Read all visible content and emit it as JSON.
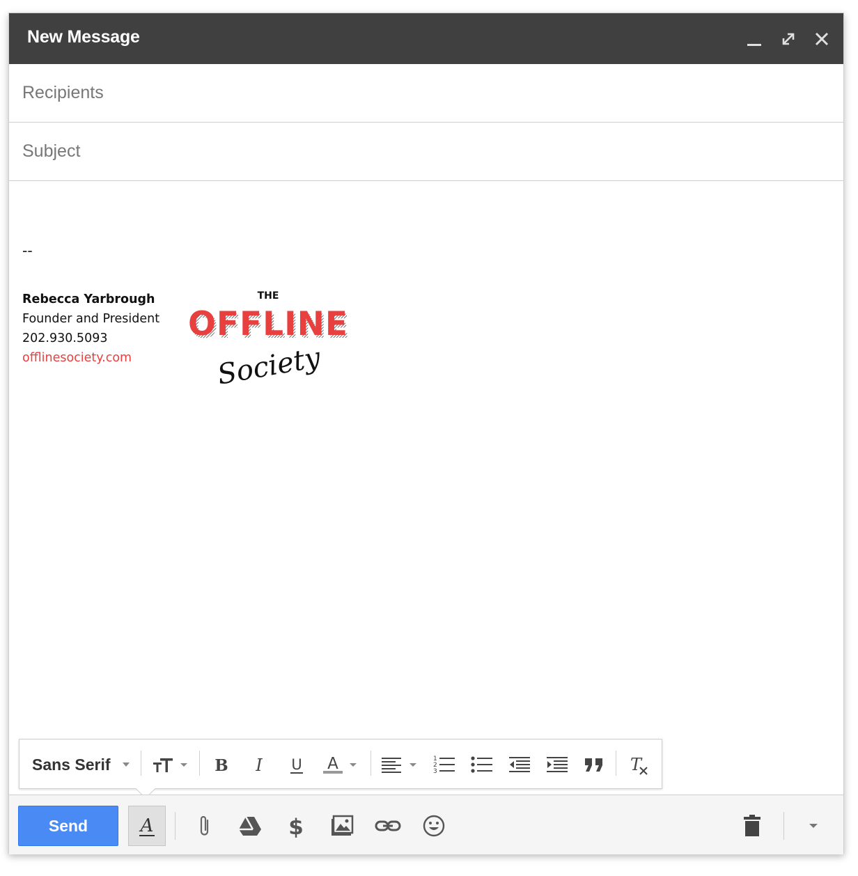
{
  "window": {
    "title": "New Message"
  },
  "fields": {
    "recipients_placeholder": "Recipients",
    "subject_placeholder": "Subject"
  },
  "signature": {
    "dash": "--",
    "name": "Rebecca Yarbrough",
    "role": "Founder and President",
    "phone": "202.930.5093",
    "website": "offlinesociety.com",
    "logo": {
      "line1": "THE",
      "line2": "OFFLINE",
      "line3": "Society"
    }
  },
  "format_toolbar": {
    "font": "Sans Serif"
  },
  "bottom_toolbar": {
    "send_label": "Send"
  },
  "colors": {
    "titlebar": "#404040",
    "send": "#4a8af4",
    "link": "#e8403f",
    "logo_red": "#e8403f",
    "icon": "#555555"
  },
  "icons": [
    "minimize-icon",
    "expand-icon",
    "close-icon",
    "text-size-icon",
    "bold-icon",
    "italic-icon",
    "underline-icon",
    "text-color-icon",
    "align-icon",
    "numbered-list-icon",
    "bulleted-list-icon",
    "indent-less-icon",
    "indent-more-icon",
    "quote-icon",
    "remove-formatting-icon",
    "formatting-options-icon",
    "attach-icon",
    "drive-icon",
    "money-icon",
    "photo-icon",
    "link-icon",
    "emoji-icon",
    "trash-icon",
    "more-options-icon"
  ]
}
